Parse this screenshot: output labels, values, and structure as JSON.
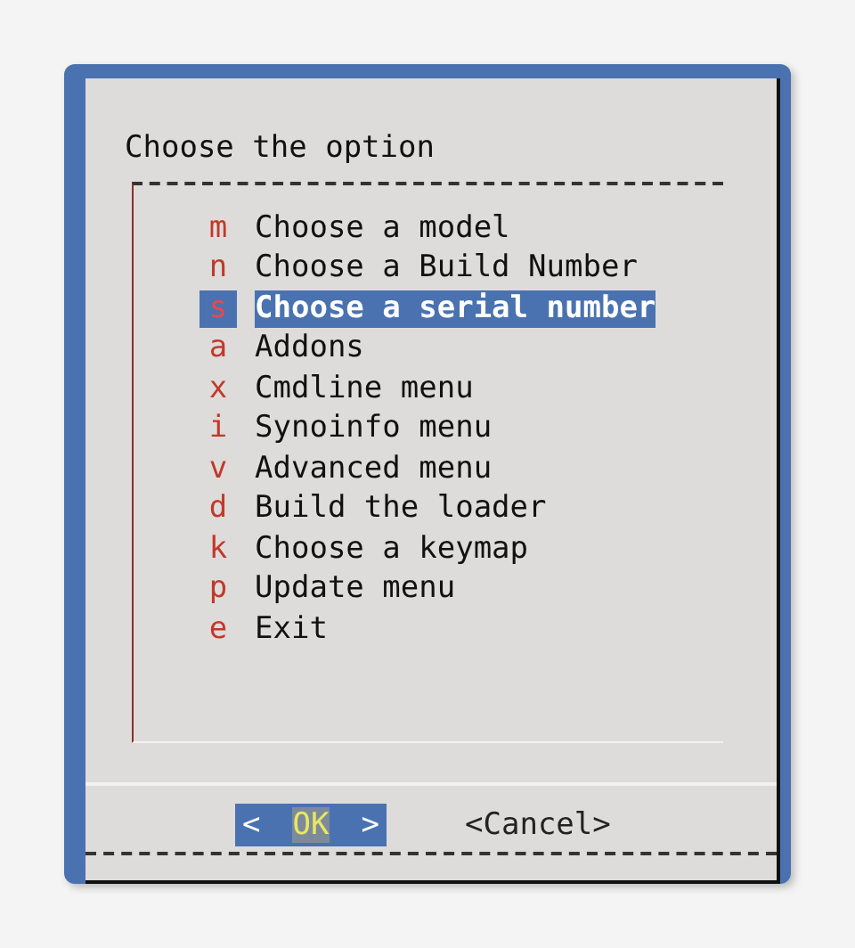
{
  "dialog": {
    "title": "Choose the option"
  },
  "menu": {
    "items": [
      {
        "hotkey": "m",
        "label": "Choose a model",
        "selected": false
      },
      {
        "hotkey": "n",
        "label": "Choose a Build Number",
        "selected": false
      },
      {
        "hotkey": "s",
        "label": "Choose a serial number",
        "selected": true
      },
      {
        "hotkey": "a",
        "label": "Addons",
        "selected": false
      },
      {
        "hotkey": "x",
        "label": "Cmdline menu",
        "selected": false
      },
      {
        "hotkey": "i",
        "label": "Synoinfo menu",
        "selected": false
      },
      {
        "hotkey": "v",
        "label": "Advanced menu",
        "selected": false
      },
      {
        "hotkey": "d",
        "label": "Build the loader",
        "selected": false
      },
      {
        "hotkey": "k",
        "label": "Choose a keymap",
        "selected": false
      },
      {
        "hotkey": "p",
        "label": "Update menu",
        "selected": false
      },
      {
        "hotkey": "e",
        "label": "Exit",
        "selected": false
      }
    ]
  },
  "buttons": [
    {
      "left": "<",
      "label": "OK",
      "right": ">",
      "selected": true
    },
    {
      "left": "<",
      "label": "Cancel",
      "right": ">",
      "selected": false
    }
  ]
}
